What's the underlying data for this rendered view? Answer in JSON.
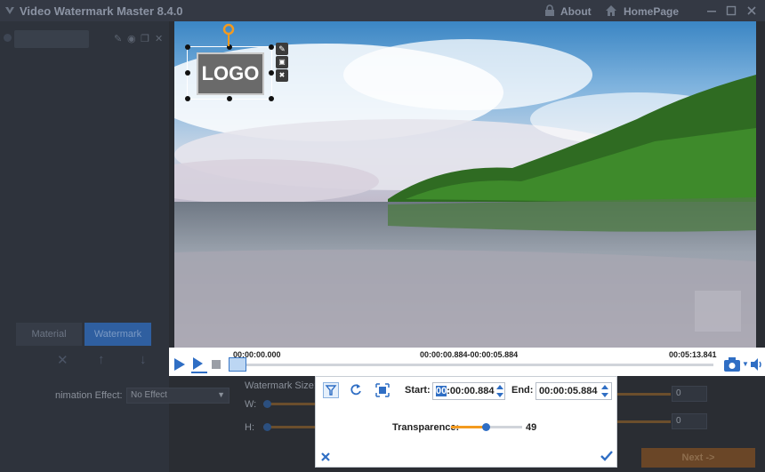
{
  "app": {
    "title": "Video Watermark Master 8.4.0",
    "about_label": "About",
    "homepage_label": "HomePage"
  },
  "left_panel": {
    "tabs": [
      "Material",
      "Watermark"
    ],
    "active_tab": "Watermark",
    "animation_label": "nimation Effect:",
    "animation_value": "No Effect"
  },
  "watermark_panel": {
    "size_label": "Watermark Size:",
    "w_label": "W:",
    "h_label": "H:",
    "x_value": "0",
    "y_value": "0"
  },
  "overlay": {
    "logo_text": "LOGO"
  },
  "player": {
    "current_time": "00:00:00.000",
    "range_time": "00:00:00.884-00:00:05.884",
    "total_time": "00:05:13.841"
  },
  "dialog": {
    "start_label": "Start:",
    "start_hour_selected": "00",
    "start_rest": ":00:00.884",
    "end_label": "End:",
    "end_value": "00:00:05.884",
    "transparence_label": "Transparence:",
    "transparence_value": "49",
    "transparence_fraction": 0.49
  },
  "footer": {
    "next_label": "Next ->"
  },
  "colors": {
    "accent_blue": "#2f6ec4",
    "accent_orange": "#f39a1f"
  }
}
